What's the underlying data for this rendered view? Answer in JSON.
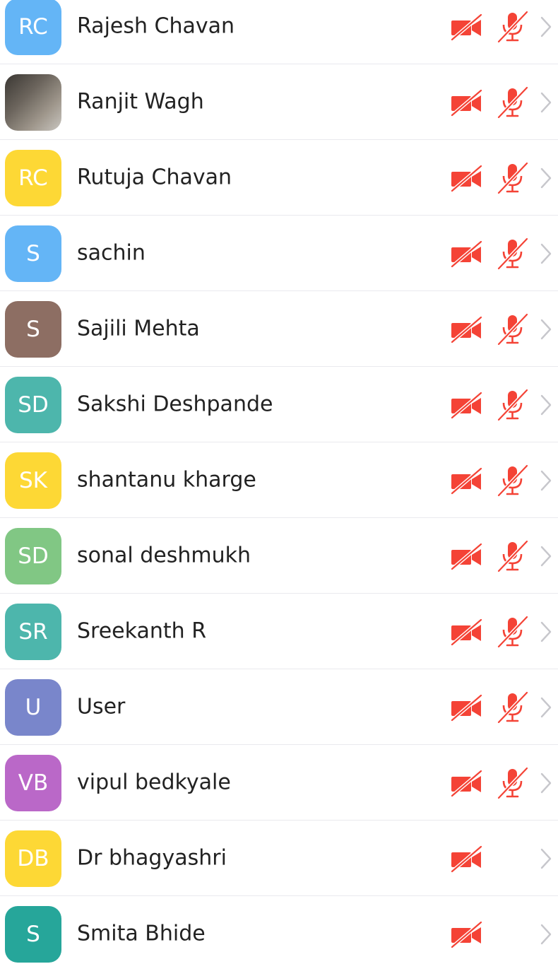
{
  "participants": [
    {
      "initials": "RC",
      "name": "Rajesh Chavan",
      "color": "#64b5f6",
      "photo": false,
      "video_muted": true,
      "audio_muted": true
    },
    {
      "initials": "",
      "name": "Ranjit Wagh",
      "color": "#8a8279",
      "photo": true,
      "video_muted": true,
      "audio_muted": true
    },
    {
      "initials": "RC",
      "name": "Rutuja Chavan",
      "color": "#fdd835",
      "photo": false,
      "video_muted": true,
      "audio_muted": true
    },
    {
      "initials": "S",
      "name": "sachin",
      "color": "#64b5f6",
      "photo": false,
      "video_muted": true,
      "audio_muted": true
    },
    {
      "initials": "S",
      "name": "Sajili Mehta",
      "color": "#8d6e63",
      "photo": false,
      "video_muted": true,
      "audio_muted": true
    },
    {
      "initials": "SD",
      "name": "Sakshi Deshpande",
      "color": "#4db6ac",
      "photo": false,
      "video_muted": true,
      "audio_muted": true
    },
    {
      "initials": "SK",
      "name": "shantanu kharge",
      "color": "#fdd835",
      "photo": false,
      "video_muted": true,
      "audio_muted": true
    },
    {
      "initials": "SD",
      "name": "sonal deshmukh",
      "color": "#81c784",
      "photo": false,
      "video_muted": true,
      "audio_muted": true
    },
    {
      "initials": "SR",
      "name": "Sreekanth R",
      "color": "#4db6ac",
      "photo": false,
      "video_muted": true,
      "audio_muted": true
    },
    {
      "initials": "U",
      "name": "User",
      "color": "#7986cb",
      "photo": false,
      "video_muted": true,
      "audio_muted": true
    },
    {
      "initials": "VB",
      "name": "vipul bedkyale",
      "color": "#ba68c8",
      "photo": false,
      "video_muted": true,
      "audio_muted": true
    },
    {
      "initials": "DB",
      "name": "Dr bhagyashri",
      "color": "#fdd835",
      "photo": false,
      "video_muted": true,
      "audio_muted": false
    },
    {
      "initials": "S",
      "name": "Smita Bhide",
      "color": "#26a69a",
      "photo": false,
      "video_muted": true,
      "audio_muted": false
    }
  ],
  "icons": {
    "video_muted": "video-off-icon",
    "audio_muted": "mic-off-icon",
    "chevron": "chevron-right-icon"
  },
  "colors": {
    "muted_red": "#f44336",
    "chevron_gray": "#c7c7cc",
    "divider": "#e9e9ee"
  }
}
